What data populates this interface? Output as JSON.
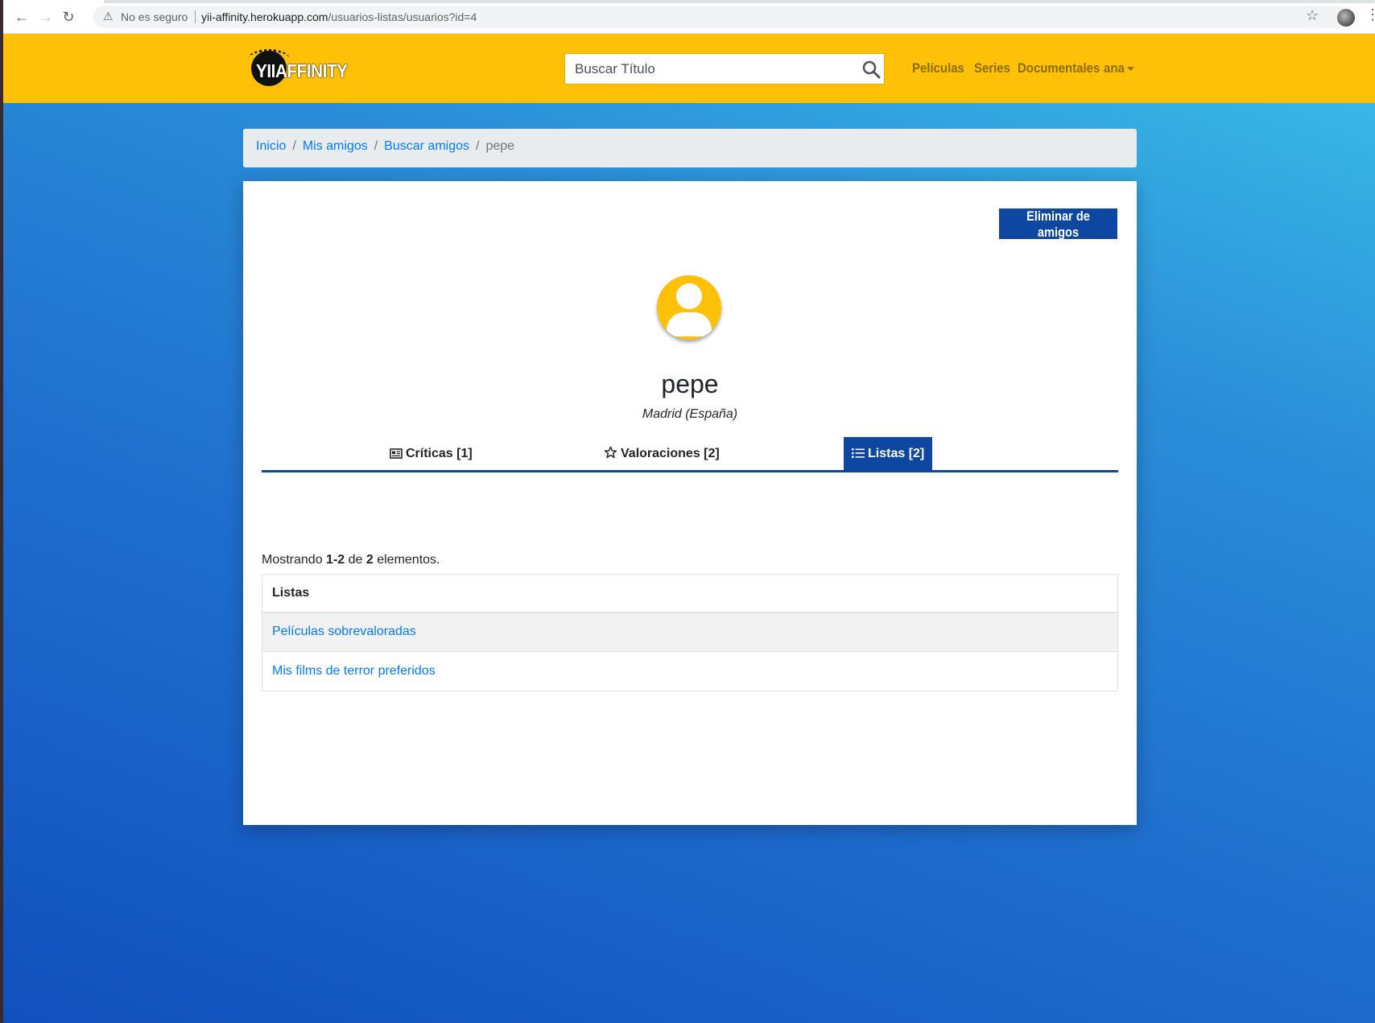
{
  "browser": {
    "insecure_label": "No es seguro",
    "url_host": "yii-affinity.herokuapp.com",
    "url_path": "/usuarios-listas/usuarios?id=4"
  },
  "navbar": {
    "logo_text": "YIIAFFINITY",
    "search_placeholder": "Buscar Título",
    "links": [
      "Películas",
      "Series",
      "Documentales"
    ],
    "user_menu": "ana"
  },
  "breadcrumb": {
    "items": [
      "Inicio",
      "Mis amigos",
      "Buscar amigos"
    ],
    "current": "pepe"
  },
  "profile": {
    "remove_button": "Eliminar de amigos",
    "username": "pepe",
    "location": "Madrid (España)",
    "tabs": [
      "Críticas [1]",
      "Valoraciones [2]",
      "Listas [2]"
    ],
    "active_tab": "Listas [2]"
  },
  "lists": {
    "summary_prefix": "Mostrando ",
    "summary_range": "1-2",
    "summary_mid": " de ",
    "summary_total": "2",
    "summary_suffix": " elementos.",
    "column_header": "Listas",
    "rows": [
      "Películas sobrevaloradas",
      "Mis films de terror preferidos"
    ]
  },
  "colors": {
    "navbar": "#ffc107",
    "primary_dark": "#0d47a1",
    "link": "#007bff"
  }
}
